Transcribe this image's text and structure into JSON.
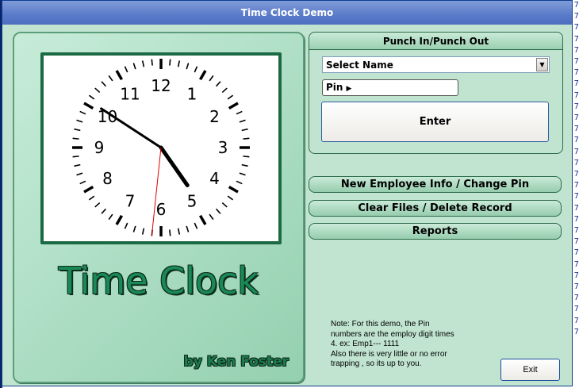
{
  "window": {
    "title": "Time Clock Demo"
  },
  "clock": {
    "numerals": [
      "12",
      "1",
      "2",
      "3",
      "4",
      "5",
      "6",
      "7",
      "8",
      "9",
      "10",
      "11"
    ],
    "time": {
      "hour": 4,
      "minute": 50,
      "second": 31
    }
  },
  "branding": {
    "title": "Time Clock",
    "byline": "by Ken Foster"
  },
  "punch": {
    "header": "Punch In/Punch Out",
    "select_name": "Select Name",
    "pin_label": "Pin",
    "enter_label": "Enter"
  },
  "buttons": {
    "new_employee": "New Employee Info / Change Pin",
    "clear_files": "Clear Files / Delete Record",
    "reports": "Reports",
    "exit": "Exit"
  },
  "note": "Note: For this demo, the Pin\nnumbers are the employ digit times\n4. ex: Emp1--- 1111\nAlso there is very little or no error\ntrapping , so its up to you.",
  "side_strip": "7",
  "colors": {
    "panel": "#c0e4cf",
    "title_green": "#198a55",
    "titlebar": "#5a7bc9"
  }
}
